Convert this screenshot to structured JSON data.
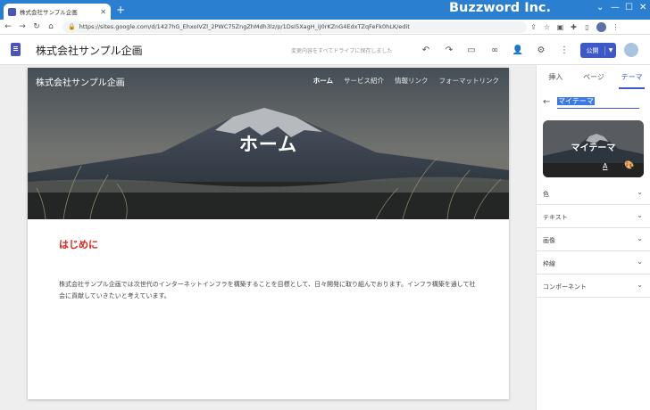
{
  "browser": {
    "tab_title": "株式会社サンプル企画",
    "new_tab": "+",
    "url": "https://sites.google.com/d/1427hG_EhxoIVZl_2PWC75ZngZhMdh3lz/p/1DsI5XagH_iJ0rKZnG4EdxTZqFeFk0hLK/edit",
    "brand": "Buzzword Inc."
  },
  "toolbar": {
    "site_name": "株式会社サンプル企画",
    "save_status": "変更内容をすべてドライブに保存しました",
    "publish_label": "公開"
  },
  "site": {
    "title": "株式会社サンプル企画",
    "nav": [
      "ホーム",
      "サービス紹介",
      "情報リンク",
      "フォーマットリンク"
    ],
    "hero_title": "ホーム",
    "section_heading": "はじめに",
    "body_text": "株式会社サンプル企画では次世代のインターネットインフラを構築することを目標として、日々開発に取り組んでおります。インフラ構築を通して社会に貢献していきたいと考えています。"
  },
  "panel": {
    "tabs": [
      "挿入",
      "ページ",
      "テーマ"
    ],
    "active_tab": "テーマ",
    "theme_name": "マイテーマ",
    "theme_card_title": "マイテーマ",
    "theme_card_font_glyph": "A",
    "rows": [
      "色",
      "テキスト",
      "画像",
      "枠線",
      "コンポーネント"
    ]
  },
  "colors": {
    "chrome_blue": "#2b7fd0",
    "publish_blue": "#3c59c7",
    "heading_red": "#e0201a"
  }
}
